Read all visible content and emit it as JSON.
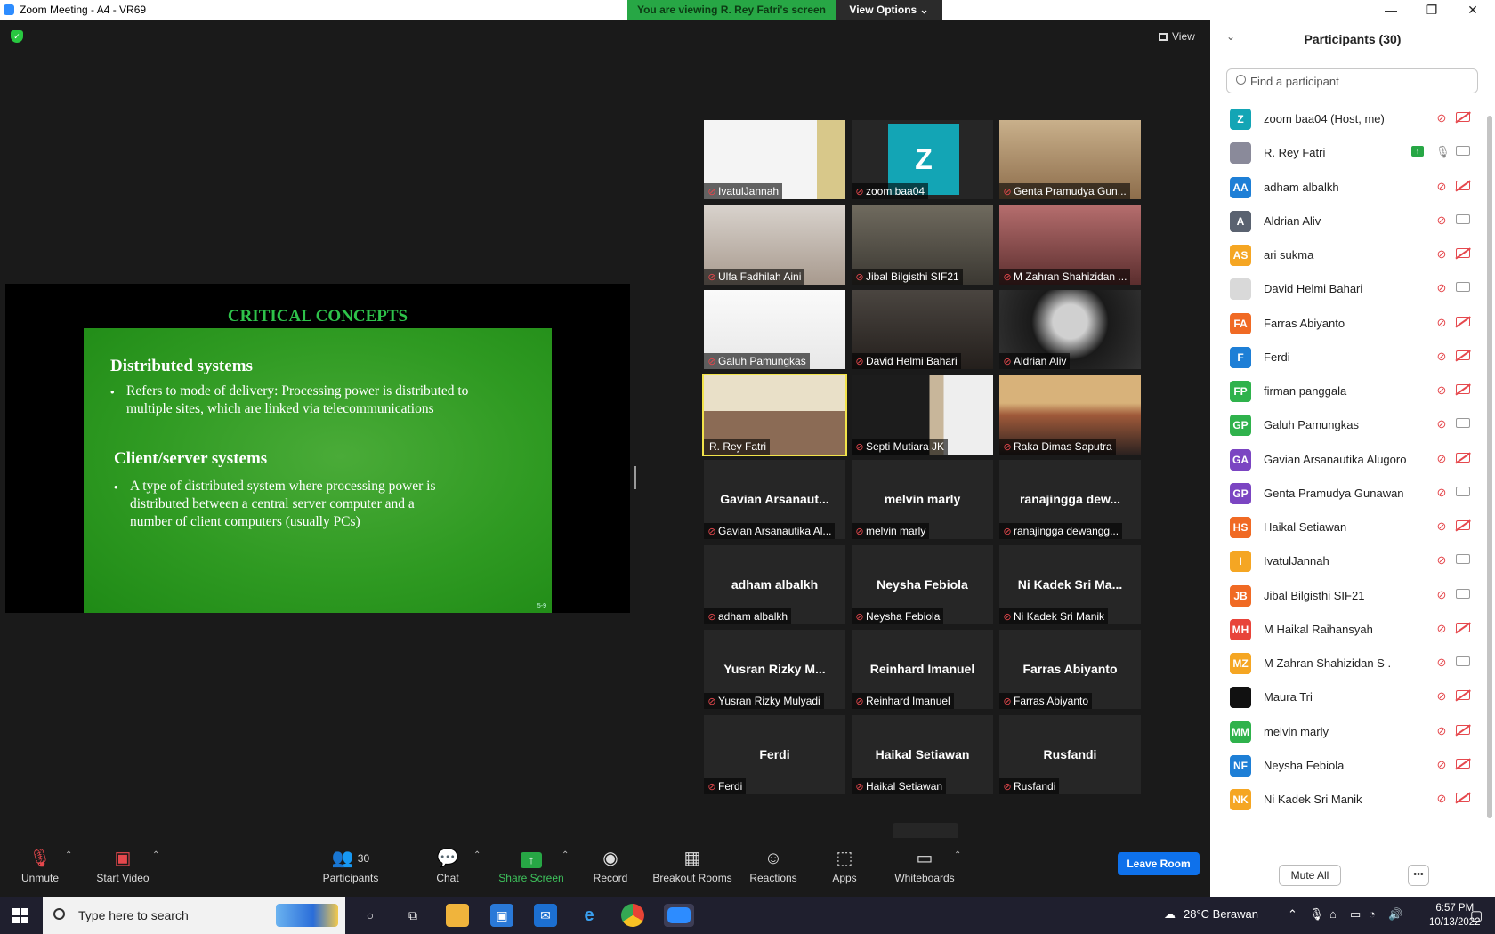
{
  "window": {
    "title": "Zoom Meeting - A4 - VR69",
    "minimize": "—",
    "maximize": "❐",
    "close": "✕"
  },
  "share_banner": {
    "text": "You are viewing R. Rey Fatri's screen",
    "view_options": "View Options ⌄"
  },
  "stage": {
    "view_label": "View"
  },
  "slide": {
    "title": "CRITICAL CONCEPTS",
    "heading1": "Distributed systems",
    "bullet1_line1": "Refers to mode of delivery: Processing power is distributed to",
    "bullet1_line2": "multiple sites, which are linked via telecommunications",
    "heading2": "Client/server systems",
    "bullet2_line1": "A type of distributed system where processing power is",
    "bullet2_line2": "distributed between a central server computer and a",
    "bullet2_line3": "number of client computers (usually PCs)",
    "bullet_glyph": "•",
    "page": "5-9"
  },
  "video_tiles": [
    {
      "label": "IvatulJannah",
      "video": true
    },
    {
      "label": "zoom baa04",
      "video": false,
      "avatar_letter": "Z",
      "avatar_color": "#13a5b5"
    },
    {
      "label": "Genta Pramudya Gun...",
      "video": true
    },
    {
      "label": "Ulfa Fadhilah Aini",
      "video": true
    },
    {
      "label": "Jibal Bilgisthi SIF21",
      "video": true
    },
    {
      "label": "M Zahran Shahizidan ...",
      "video": true
    },
    {
      "label": "Galuh Pamungkas",
      "video": true
    },
    {
      "label": "David Helmi Bahari",
      "video": true
    },
    {
      "label": "Aldrian Aliv",
      "video": true
    },
    {
      "label": "R. Rey Fatri",
      "video": true,
      "active_speaker": true,
      "muted": false
    },
    {
      "label": "Septi Mutiara JK",
      "video": true
    },
    {
      "label": "Raka Dimas Saputra",
      "video": true
    },
    {
      "label": "Gavian Arsanautika Al...",
      "big_name": "Gavian Arsanaut...",
      "video": false
    },
    {
      "label": "melvin marly",
      "big_name": "melvin marly",
      "video": false
    },
    {
      "label": "ranajingga dewangg...",
      "big_name": "ranajingga dew...",
      "video": false
    },
    {
      "label": "adham albalkh",
      "big_name": "adham albalkh",
      "video": false
    },
    {
      "label": "Neysha Febiola",
      "big_name": "Neysha Febiola",
      "video": false
    },
    {
      "label": "Ni Kadek Sri Manik",
      "big_name": "Ni Kadek Sri Ma...",
      "video": false
    },
    {
      "label": "Yusran Rizky Mulyadi",
      "big_name": "Yusran Rizky M...",
      "video": false
    },
    {
      "label": "Reinhard Imanuel",
      "big_name": "Reinhard Imanuel",
      "video": false
    },
    {
      "label": "Farras Abiyanto",
      "big_name": "Farras Abiyanto",
      "video": false
    },
    {
      "label": "Ferdi",
      "big_name": "Ferdi",
      "video": false
    },
    {
      "label": "Haikal Setiawan",
      "big_name": "Haikal Setiawan",
      "video": false
    },
    {
      "label": "Rusfandi",
      "big_name": "Rusfandi",
      "video": false
    }
  ],
  "toolbar": {
    "unmute": "Unmute",
    "start_video": "Start Video",
    "participants": "Participants",
    "participants_count": "30",
    "chat": "Chat",
    "share_screen": "Share Screen",
    "record": "Record",
    "breakout_rooms": "Breakout Rooms",
    "reactions": "Reactions",
    "apps": "Apps",
    "whiteboards": "Whiteboards",
    "leave": "Leave Room",
    "share_color": "#27a745"
  },
  "participants_panel": {
    "title": "Participants (30)",
    "search_placeholder": "Find a participant",
    "mute_all": "Mute All",
    "more": "•••",
    "list": [
      {
        "initials": "Z",
        "name": "zoom baa04 (Host, me)",
        "color": "#13a5b5",
        "mic": "off",
        "cam": "off"
      },
      {
        "initials": "",
        "name": "R. Rey Fatri",
        "color": "#8a8a9a",
        "mic": "on",
        "cam": "on",
        "sharing": true,
        "photo": true
      },
      {
        "initials": "AA",
        "name": "adham albalkh",
        "color": "#1e7fd6",
        "mic": "off",
        "cam": "off"
      },
      {
        "initials": "A",
        "name": "Aldrian Aliv",
        "color": "#5a6270",
        "mic": "off",
        "cam": "on"
      },
      {
        "initials": "AS",
        "name": "ari sukma",
        "color": "#f5a623",
        "mic": "off",
        "cam": "off"
      },
      {
        "initials": "",
        "name": "David Helmi Bahari",
        "color": "#d9d9d9",
        "mic": "off",
        "cam": "on",
        "photo": true
      },
      {
        "initials": "FA",
        "name": "Farras Abiyanto",
        "color": "#f06a24",
        "mic": "off",
        "cam": "off"
      },
      {
        "initials": "F",
        "name": "Ferdi",
        "color": "#1e7fd6",
        "mic": "off",
        "cam": "off"
      },
      {
        "initials": "FP",
        "name": "firman panggala",
        "color": "#2fb24c",
        "mic": "off",
        "cam": "off"
      },
      {
        "initials": "GP",
        "name": "Galuh Pamungkas",
        "color": "#2fb24c",
        "mic": "off",
        "cam": "on"
      },
      {
        "initials": "GA",
        "name": "Gavian Arsanautika Alugoro",
        "color": "#7b45c2",
        "mic": "off",
        "cam": "off"
      },
      {
        "initials": "GP",
        "name": "Genta Pramudya Gunawan",
        "color": "#7b45c2",
        "mic": "off",
        "cam": "on"
      },
      {
        "initials": "HS",
        "name": "Haikal Setiawan",
        "color": "#f06a24",
        "mic": "off",
        "cam": "off"
      },
      {
        "initials": "I",
        "name": "IvatulJannah",
        "color": "#f5a623",
        "mic": "off",
        "cam": "on"
      },
      {
        "initials": "JB",
        "name": "Jibal Bilgisthi SIF21",
        "color": "#f06a24",
        "mic": "off",
        "cam": "on"
      },
      {
        "initials": "MH",
        "name": "M Haikal Raihansyah",
        "color": "#e8443a",
        "mic": "off",
        "cam": "off"
      },
      {
        "initials": "MZ",
        "name": "M Zahran Shahizidan S .",
        "color": "#f5a623",
        "mic": "off",
        "cam": "on"
      },
      {
        "initials": "",
        "name": "Maura Tri",
        "color": "#111111",
        "mic": "off",
        "cam": "off",
        "photo": true
      },
      {
        "initials": "MM",
        "name": "melvin marly",
        "color": "#2fb24c",
        "mic": "off",
        "cam": "off"
      },
      {
        "initials": "NF",
        "name": "Neysha Febiola",
        "color": "#1e7fd6",
        "mic": "off",
        "cam": "off"
      },
      {
        "initials": "NK",
        "name": "Ni Kadek Sri Manik",
        "color": "#f5a623",
        "mic": "off",
        "cam": "off"
      }
    ]
  },
  "taskbar": {
    "search_text": "Type here to search",
    "weather": "28°C  Berawan",
    "time": "6:57 PM",
    "date": "10/13/2022"
  }
}
